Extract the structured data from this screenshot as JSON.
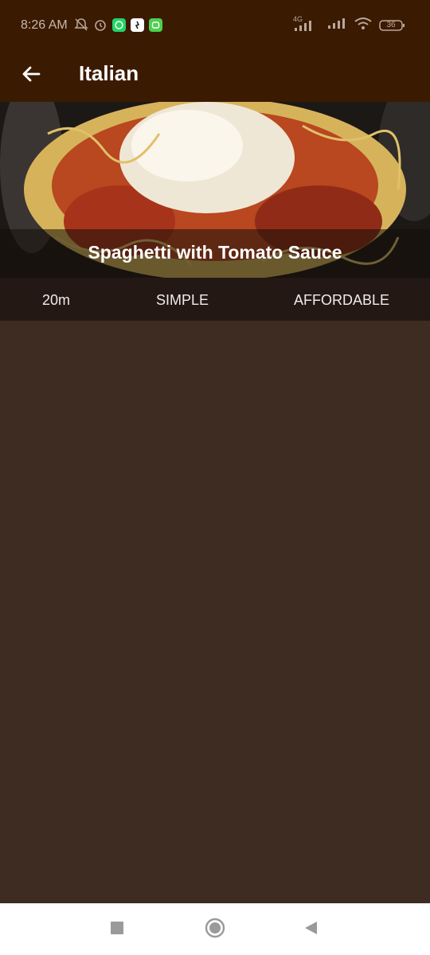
{
  "status_bar": {
    "time": "8:26 AM",
    "left_icons": [
      "bell-off-icon",
      "alarm-icon",
      "whatsapp-icon",
      "app-icon",
      "message-icon"
    ],
    "right_icons": [
      "signal-4g-icon",
      "signal-icon",
      "wifi-icon",
      "battery-icon"
    ],
    "signal_label": "4G",
    "battery_level": "36"
  },
  "app_bar": {
    "title": "Italian",
    "back_icon": "arrow-left-icon"
  },
  "meal": {
    "title": "Spaghetti with Tomato Sauce",
    "duration": "20m",
    "complexity": "SIMPLE",
    "affordability": "AFFORDABLE"
  },
  "nav_bar": {
    "buttons": [
      "recents-button",
      "home-button",
      "back-button"
    ]
  },
  "colors": {
    "app_bar": "#3b1a02",
    "background": "#3e2c23",
    "meta_bar": "#231814",
    "nav_bar": "#ffffff"
  }
}
